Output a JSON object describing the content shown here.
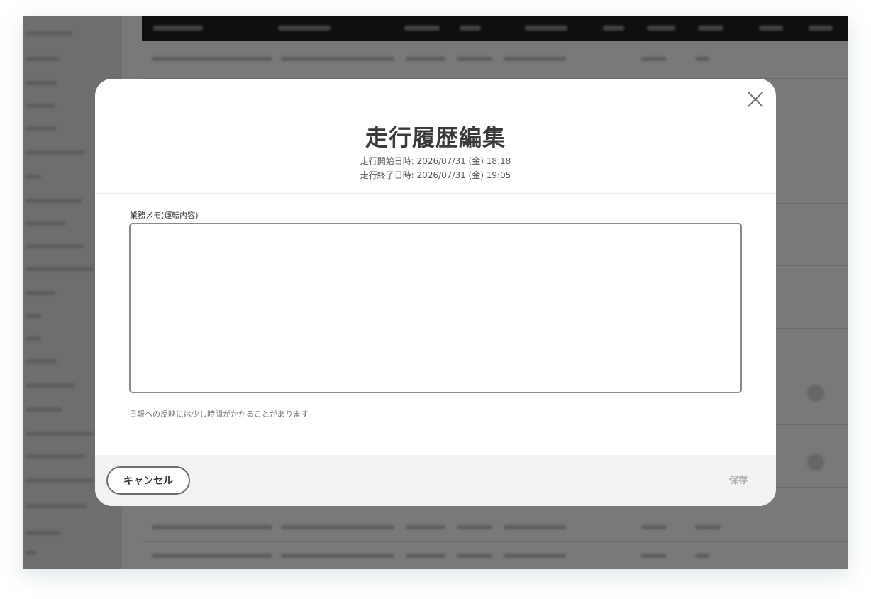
{
  "modal": {
    "title": "走行履歴編集",
    "start_datetime": "走行開始日時: 2026/07/31 (金) 18:18",
    "end_datetime": "走行終了日時: 2026/07/31 (金) 19:05",
    "memo_label": "業務メモ(運転内容)",
    "memo_value": "",
    "hint": "日報への反映には少し時間がかかることがあります",
    "cancel_label": "キャンセル",
    "save_label": "保存",
    "close_icon": "close-icon"
  },
  "colors": {
    "overlay": "#7a7a7a",
    "header_dark": "#0f0f0f",
    "modal_bg": "#ffffff",
    "footer_bg": "#f2f2f2",
    "title_text": "#3a3a3a",
    "save_disabled": "#b0b0b0"
  }
}
